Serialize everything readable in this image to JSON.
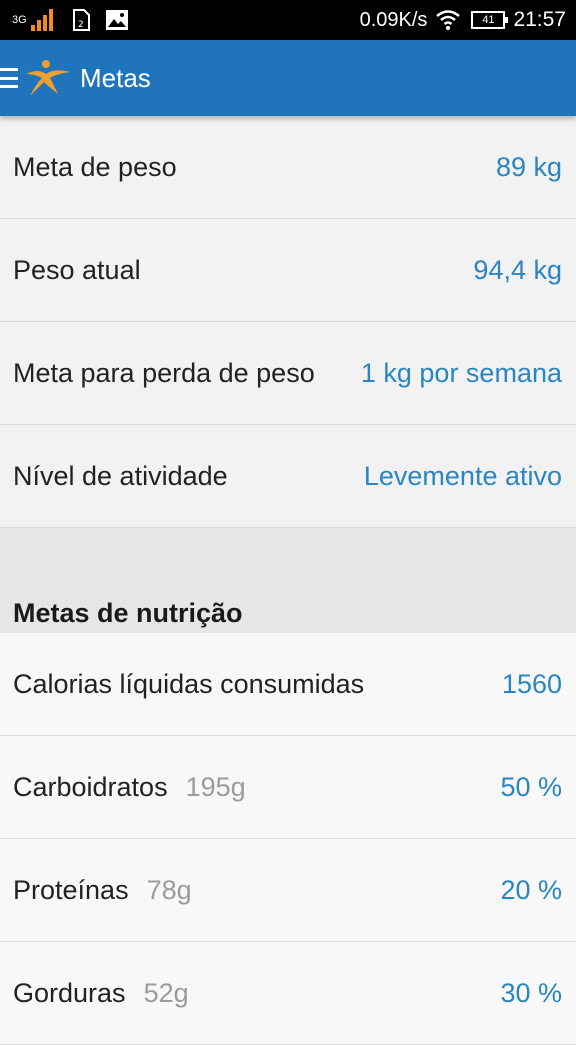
{
  "status_bar": {
    "network": "3G",
    "speed": "0.09K/s",
    "battery": "41",
    "clock": "21:57"
  },
  "app_bar": {
    "title": "Metas"
  },
  "goals": [
    {
      "label": "Meta de peso",
      "value": "89 kg"
    },
    {
      "label": "Peso atual",
      "value": "94,4 kg"
    },
    {
      "label": "Meta para perda de peso",
      "value": "1 kg por semana"
    },
    {
      "label": "Nível de atividade",
      "value": "Levemente ativo"
    }
  ],
  "nutrition": {
    "title": "Metas de nutrição",
    "rows": [
      {
        "label": "Calorias líquidas consumidas",
        "sub": "",
        "value": "1560"
      },
      {
        "label": "Carboidratos",
        "sub": "195g",
        "value": "50 %"
      },
      {
        "label": "Proteínas",
        "sub": "78g",
        "value": "20 %"
      },
      {
        "label": "Gorduras",
        "sub": "52g",
        "value": "30 %"
      }
    ]
  },
  "colors": {
    "app_bar": "#1f74bc",
    "value_text": "#2a86c3",
    "logo": "#f0a030"
  }
}
